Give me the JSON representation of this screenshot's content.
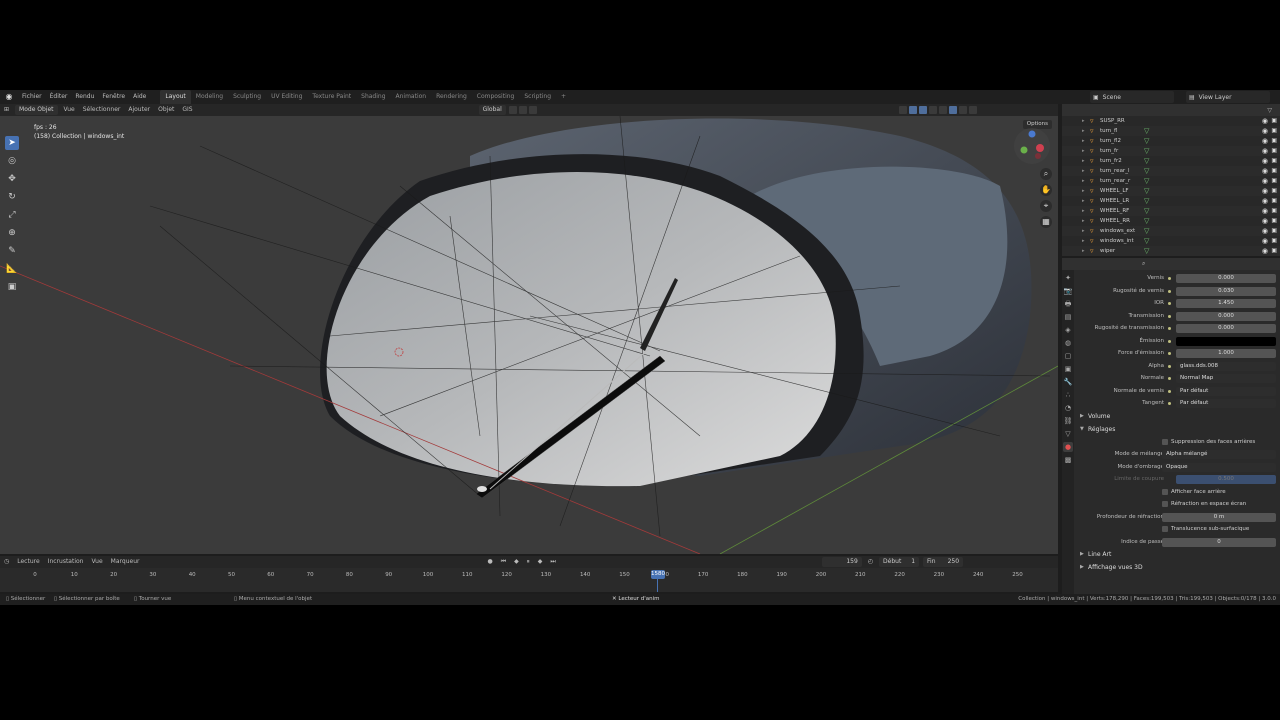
{
  "menu": [
    "Fichier",
    "Éditer",
    "Rendu",
    "Fenêtre",
    "Aide"
  ],
  "workspaces": [
    "Layout",
    "Modeling",
    "Sculpting",
    "UV Editing",
    "Texture Paint",
    "Shading",
    "Animation",
    "Rendering",
    "Compositing",
    "Scripting"
  ],
  "scene": {
    "name": "Scene",
    "view_layer": "View Layer"
  },
  "viewport_header": {
    "mode": "Mode Objet",
    "menus": [
      "Vue",
      "Sélectionner",
      "Ajouter",
      "Objet",
      "GIS"
    ],
    "orientation": "Global",
    "options": "Options"
  },
  "overlay": {
    "fps": "fps : 26",
    "collection": "(158) Collection | windows_int"
  },
  "outliner": {
    "items": [
      {
        "name": "SUSP_RR",
        "mesh": false
      },
      {
        "name": "turn_fl",
        "mesh": true
      },
      {
        "name": "turn_fl2",
        "mesh": true
      },
      {
        "name": "turn_fr",
        "mesh": true
      },
      {
        "name": "turn_fr2",
        "mesh": true
      },
      {
        "name": "turn_rear_l",
        "mesh": true
      },
      {
        "name": "turn_rear_r",
        "mesh": true
      },
      {
        "name": "WHEEL_LF",
        "mesh": true
      },
      {
        "name": "WHEEL_LR",
        "mesh": true
      },
      {
        "name": "WHEEL_RF",
        "mesh": true
      },
      {
        "name": "WHEEL_RR",
        "mesh": true
      },
      {
        "name": "windows_ext",
        "mesh": true
      },
      {
        "name": "windows_int",
        "mesh": true
      },
      {
        "name": "wiper",
        "mesh": true
      }
    ]
  },
  "properties": {
    "rows": [
      {
        "label": "Vernis",
        "value": "0.000"
      },
      {
        "label": "Rugosité de vernis",
        "value": "0.030"
      },
      {
        "label": "IOR",
        "value": "1.450"
      },
      {
        "label": "Transmission",
        "value": "0.000"
      },
      {
        "label": "Rugosité de transmission",
        "value": "0.000"
      },
      {
        "label": "Émission",
        "value": ""
      },
      {
        "label": "Force d'émission",
        "value": "1.000"
      },
      {
        "label": "Alpha",
        "value": "glass.dds.008"
      },
      {
        "label": "Normale",
        "value": "Normal Map"
      },
      {
        "label": "Normale de vernis",
        "value": "Par défaut"
      },
      {
        "label": "Tangent",
        "value": "Par défaut"
      }
    ],
    "section_volume": "Volume",
    "section_settings": "Réglages",
    "backface_culling": "Suppression des faces arrières",
    "blend_mode_label": "Mode de mélange",
    "blend_mode_value": "Alpha mélangé",
    "shadow_mode_label": "Mode d'ombrage",
    "shadow_mode_value": "Opaque",
    "clip_label": "Limite de coupure",
    "clip_value": "0.500",
    "show_backface": "Afficher face arrière",
    "screen_refraction": "Réfraction en espace écran",
    "refraction_depth_label": "Profondeur de réfraction",
    "refraction_depth_value": "0 m",
    "sss_translucency": "Translucence sub-surfacique",
    "pass_index_label": "Indice de passe",
    "pass_index_value": "0",
    "section_lineart": "Line Art",
    "section_viewport": "Affichage vues 3D"
  },
  "timeline": {
    "menus": [
      "Lecture",
      "Incrustation",
      "Vue",
      "Marqueur"
    ],
    "current_frame": "159",
    "start_label": "Début",
    "start": "1",
    "end_label": "Fin",
    "end": "250",
    "ticks": [
      "0",
      "10",
      "20",
      "30",
      "40",
      "50",
      "60",
      "70",
      "80",
      "90",
      "100",
      "110",
      "120",
      "130",
      "140",
      "150",
      "160",
      "170",
      "180",
      "190",
      "200",
      "210",
      "220",
      "230",
      "240",
      "250"
    ],
    "marker": "1580"
  },
  "statusbar": {
    "select": "Sélectionner",
    "box_select": "Sélectionner par boîte",
    "rotate_view": "Tourner vue",
    "context_menu": "Menu contextuel de l'objet",
    "anim_player": "Lecteur d'anim",
    "stats": "Collection | windows_int | Verts:178,290 | Faces:199,503 | Tris:199,503 | Objects:0/178 | 3.0.0"
  }
}
